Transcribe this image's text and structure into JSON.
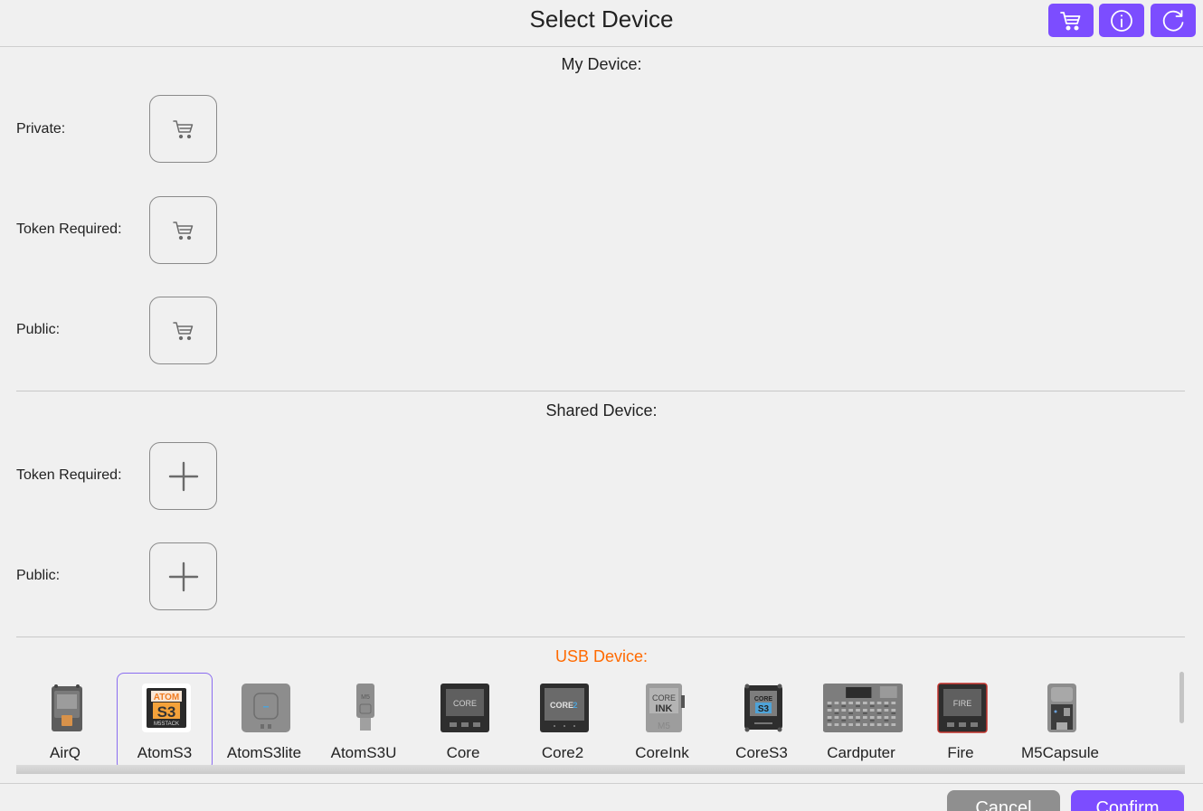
{
  "header": {
    "title": "Select Device",
    "buttons": [
      "cart-icon",
      "info-icon",
      "refresh-icon"
    ]
  },
  "my_device": {
    "title": "My Device:",
    "rows": [
      {
        "label": "Private:",
        "icon": "cart-icon"
      },
      {
        "label": "Token Required:",
        "icon": "cart-icon"
      },
      {
        "label": "Public:",
        "icon": "cart-icon"
      }
    ]
  },
  "shared_device": {
    "title": "Shared Device:",
    "rows": [
      {
        "label": "Token Required:",
        "icon": "plus-icon"
      },
      {
        "label": "Public:",
        "icon": "plus-icon"
      }
    ]
  },
  "usb_device": {
    "title": "USB Device:",
    "selected": "AtomS3",
    "devices": [
      "AirQ",
      "AtomS3",
      "AtomS3lite",
      "AtomS3U",
      "Core",
      "Core2",
      "CoreInk",
      "CoreS3",
      "Cardputer",
      "Fire",
      "M5Capsule"
    ],
    "image_text": {
      "atoms3_brand": "ATOM",
      "atoms3_model": "S3",
      "atoms3_maker": "M5STACK",
      "atoms3u_mark": "M5",
      "core_screen": "CORE",
      "core2_screen": "CORE",
      "core2_suffix": "2",
      "coreink_top": "CORE",
      "coreink_bottom": "INK",
      "coreink_logo": "M5",
      "cores3_top": "CORE",
      "cores3_bottom": "S3",
      "fire_screen": "FIRE"
    }
  },
  "footer": {
    "cancel_label": "Cancel",
    "confirm_label": "Confirm"
  },
  "colors": {
    "accent": "#7c4dff",
    "usb_title": "#ff6a00",
    "cancel": "#8f8f8f",
    "background": "#f0f0f0"
  }
}
